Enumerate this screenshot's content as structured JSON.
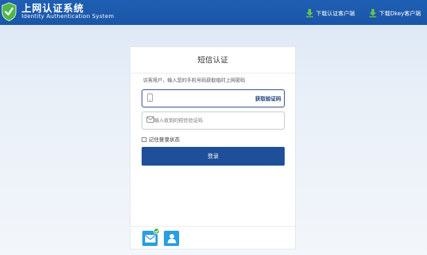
{
  "header": {
    "title_cn": "上网认证系统",
    "title_en": "Identity Authentication System",
    "download_client": "下载认证客户端",
    "download_dkey": "下载Dkey客户端",
    "brand_color": "#1f5fb3",
    "logo_icon": "shield-check-icon"
  },
  "card": {
    "title": "短信认证",
    "hint": "访客用户，输入您的手机号码获取临时上网密码",
    "phone_value": "",
    "phone_placeholder": "",
    "get_code_label": "获取验证码",
    "code_placeholder": "输入收到的短信验证码",
    "remember_label": "记住登录状态",
    "remember_checked": false,
    "login_label": "登录",
    "button_color": "#1f4f99"
  },
  "footer_modes": [
    {
      "icon": "envelope-icon",
      "selected": true
    },
    {
      "icon": "user-icon",
      "selected": false
    }
  ]
}
